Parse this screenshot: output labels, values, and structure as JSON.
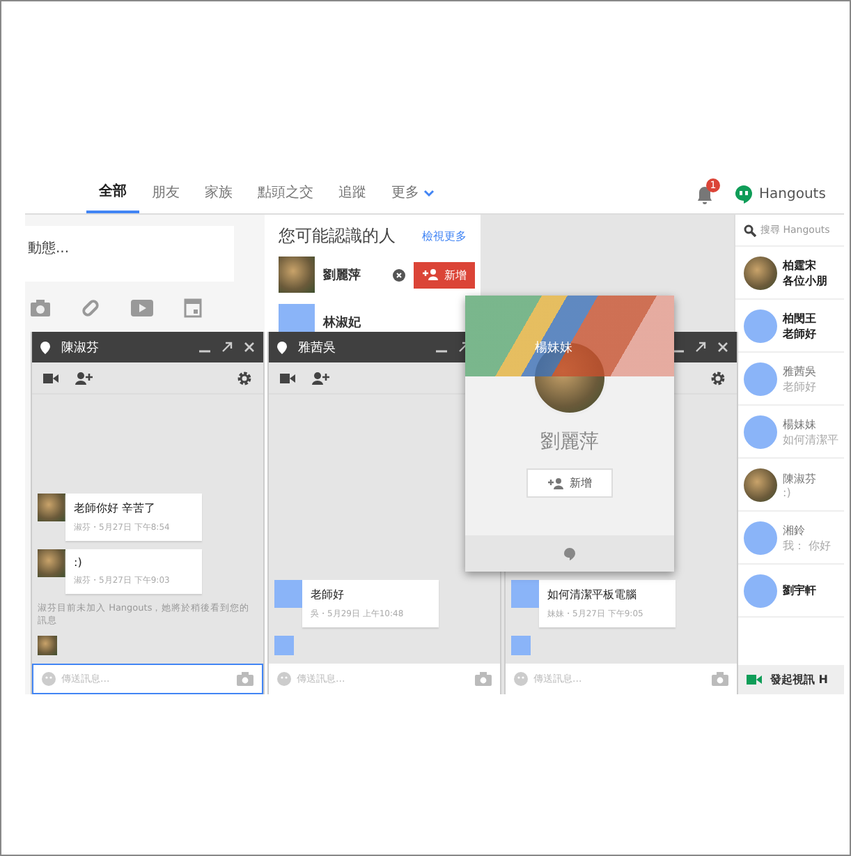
{
  "nav": {
    "tabs": [
      {
        "label": "全部",
        "selected": true
      },
      {
        "label": "朋友",
        "selected": false
      },
      {
        "label": "家族",
        "selected": false
      },
      {
        "label": "點頭之交",
        "selected": false
      },
      {
        "label": "追蹤",
        "selected": false
      }
    ],
    "more": "更多",
    "notification_count": "1",
    "app_title": "Hangouts"
  },
  "composer": {
    "placeholder": "動態..."
  },
  "suggestions": {
    "title": "您可能認識的人",
    "view_more": "檢視更多",
    "people": [
      {
        "name": "劉麗萍",
        "action": "新增"
      },
      {
        "name": "林淑妃"
      }
    ]
  },
  "chats": [
    {
      "title": "陳淑芬",
      "placeholder": "傳送訊息...",
      "messages": [
        {
          "text": "老師你好 辛苦了",
          "meta": "淑芬・5月27日 下午8:54",
          "has_photo": true
        },
        {
          "text": ":)",
          "meta": "淑芬・5月27日 下午9:03",
          "has_photo": true
        }
      ],
      "notice": "淑芬目前未加入 Hangouts，她將於稍後看到您的訊息",
      "seen_has_photo": true
    },
    {
      "title": "雅茜吳",
      "placeholder": "傳送訊息...",
      "messages": [
        {
          "text": "老師好",
          "meta": "吳・5月29日 上午10:48",
          "has_photo": false
        }
      ],
      "seen_has_photo": false
    },
    {
      "title": "楊妹妹",
      "placeholder": "傳送訊息...",
      "messages": [
        {
          "text": "如何清潔平板電腦",
          "meta": "妹妹・5月27日 下午9:05",
          "has_photo": false
        }
      ],
      "seen_has_photo": false
    }
  ],
  "profile_card": {
    "name": "劉麗萍",
    "action": "新增"
  },
  "sidebar": {
    "search_placeholder": "搜尋 Hangouts",
    "contacts": [
      {
        "name": "柏霆宋",
        "preview": "各位小朋",
        "has_photo": true,
        "unread": true
      },
      {
        "name": "柏閔王",
        "preview": "老師好",
        "has_photo": false,
        "unread": true
      },
      {
        "name": "雅茜吳",
        "preview": "老師好",
        "has_photo": false,
        "unread": false
      },
      {
        "name": "楊妹妹",
        "preview": "如何清潔平",
        "has_photo": false,
        "unread": false
      },
      {
        "name": "陳淑芬",
        "preview": ":)",
        "has_photo": true,
        "unread": false
      },
      {
        "name": "湘鈴",
        "preview": "我： 你好",
        "has_photo": false,
        "unread": false
      },
      {
        "name": "劉宇軒",
        "has_photo": false,
        "unread": true
      }
    ],
    "video_call": "發起視訊 H"
  }
}
